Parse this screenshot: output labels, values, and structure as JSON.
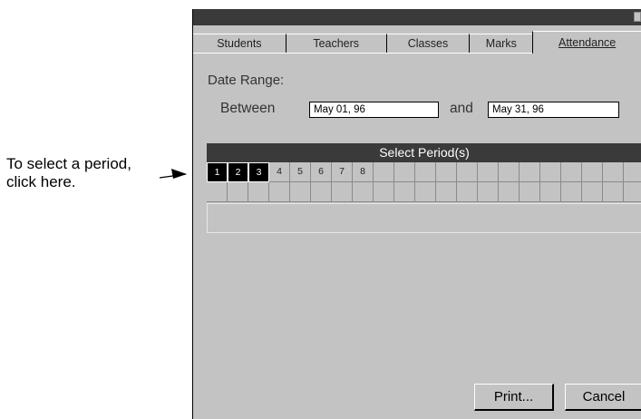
{
  "callout": {
    "line1": "To select a period,",
    "line2": "click here."
  },
  "tabs": [
    "Students",
    "Teachers",
    "Classes",
    "Marks",
    "Attendance"
  ],
  "date_range": {
    "label": "Date Range:",
    "between_label": "Between",
    "start_value": "May 01, 96",
    "and_label": "and",
    "end_value": "May 31, 96"
  },
  "periods": {
    "header": "Select Period(s)",
    "items": [
      "1",
      "2",
      "3",
      "4",
      "5",
      "6",
      "7",
      "8"
    ],
    "selected": [
      "1",
      "2",
      "3"
    ]
  },
  "buttons": {
    "print": "Print...",
    "cancel": "Cancel"
  },
  "colors": {
    "window_bg": "#c3c3c3",
    "titlebar": "#3a3a3a",
    "selected_cell": "#000000"
  }
}
